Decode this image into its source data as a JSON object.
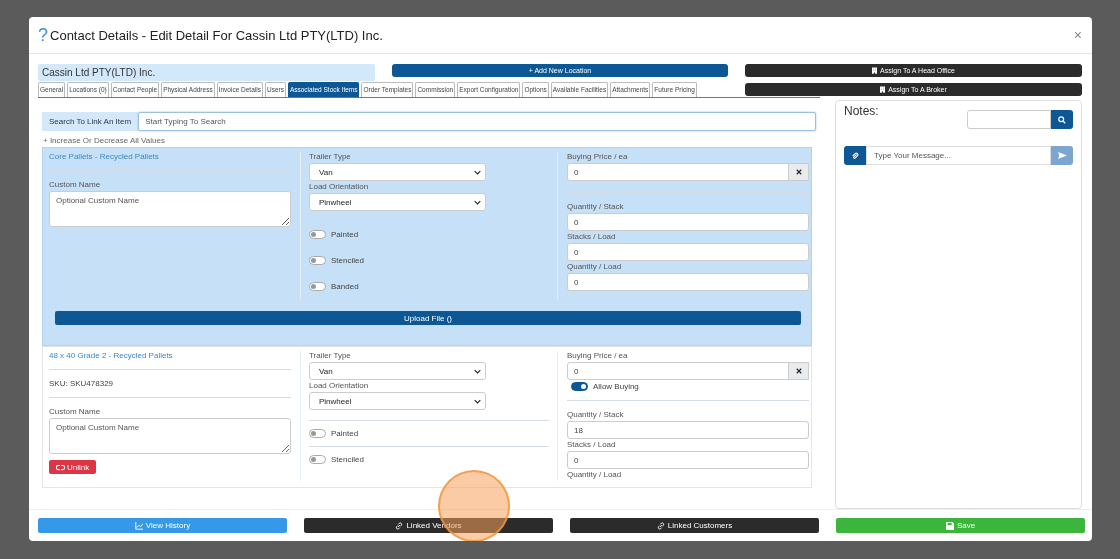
{
  "dialog": {
    "help": "?",
    "title": "Contact Details - Edit Detail For Cassin Ltd PTY(LTD) Inc.",
    "close": "×"
  },
  "company_name": "Cassin Ltd PTY(LTD) Inc.",
  "add_location_button": "+ Add New Location",
  "assign_buttons": [
    "Assign To A Head Office",
    "Assign To A Broker"
  ],
  "tabs": [
    {
      "label": "General",
      "selected": false
    },
    {
      "label": "Locations (0)",
      "selected": false
    },
    {
      "label": "Contact People",
      "selected": false
    },
    {
      "label": "Physical Address",
      "selected": false
    },
    {
      "label": "Invoice Details",
      "selected": false
    },
    {
      "label": "Users",
      "selected": false
    },
    {
      "label": "Associated Stock Items",
      "selected": true
    },
    {
      "label": "Order Templates",
      "selected": false
    },
    {
      "label": "Commission",
      "selected": false
    },
    {
      "label": "Export Configuration",
      "selected": false
    },
    {
      "label": "Options",
      "selected": false
    },
    {
      "label": "Available Facilities",
      "selected": false
    },
    {
      "label": "Attachments",
      "selected": false
    },
    {
      "label": "Future Pricing",
      "selected": false
    }
  ],
  "search": {
    "label": "Search To Link An Item",
    "placeholder": "Start Typing To Search"
  },
  "adjust_link": "+ Increase Or Decrease All Values",
  "items": [
    {
      "title": "Core Pallets - Recycled Pallets",
      "selected": true,
      "custom_name_label": "Custom Name",
      "custom_name_placeholder": "Optional Custom Name",
      "trailer_label": "Trailer Type",
      "trailer": "Van",
      "orientation_label": "Load Orientation",
      "orientation": "Pinwheel",
      "toggles": [
        {
          "label": "Painted",
          "on": false
        },
        {
          "label": "Stenciled",
          "on": false
        },
        {
          "label": "Banded",
          "on": false
        }
      ],
      "price_label": "Buying Price / ea",
      "price": "0",
      "quantities": [
        {
          "label": "Quantity / Stack",
          "value": "0"
        },
        {
          "label": "Stacks / Load",
          "value": "0"
        },
        {
          "label": "Quantity / Load",
          "value": "0"
        }
      ],
      "upload_button": "Upload File ()"
    },
    {
      "title": "48 x 40 Grade 2 - Recycled Pallets",
      "selected": false,
      "sku": "SKU: SKU478329",
      "custom_name_label": "Custom Name",
      "custom_name_placeholder": "Optional Custom Name",
      "unlink_button": "Unlink",
      "trailer_label": "Trailer Type",
      "trailer": "Van",
      "orientation_label": "Load Orientation",
      "orientation": "Pinwheel",
      "toggles": [
        {
          "label": "Painted",
          "on": false
        },
        {
          "label": "Stenciled",
          "on": false
        }
      ],
      "price_label": "Buying Price / ea",
      "price": "0",
      "allow_buying": {
        "label": "Allow Buying",
        "on": true
      },
      "quantities": [
        {
          "label": "Quantity / Stack",
          "value": "18"
        },
        {
          "label": "Stacks / Load",
          "value": "0"
        },
        {
          "label": "Quantity / Load"
        }
      ]
    }
  ],
  "notes": {
    "title": "Notes:",
    "message_placeholder": "Type Your Message..."
  },
  "footer_buttons": [
    {
      "label": "View History",
      "kind": "history"
    },
    {
      "label": "Linked Vendors",
      "kind": "vendors"
    },
    {
      "label": "Linked Customers",
      "kind": "customers"
    },
    {
      "label": "Save",
      "kind": "save"
    }
  ]
}
